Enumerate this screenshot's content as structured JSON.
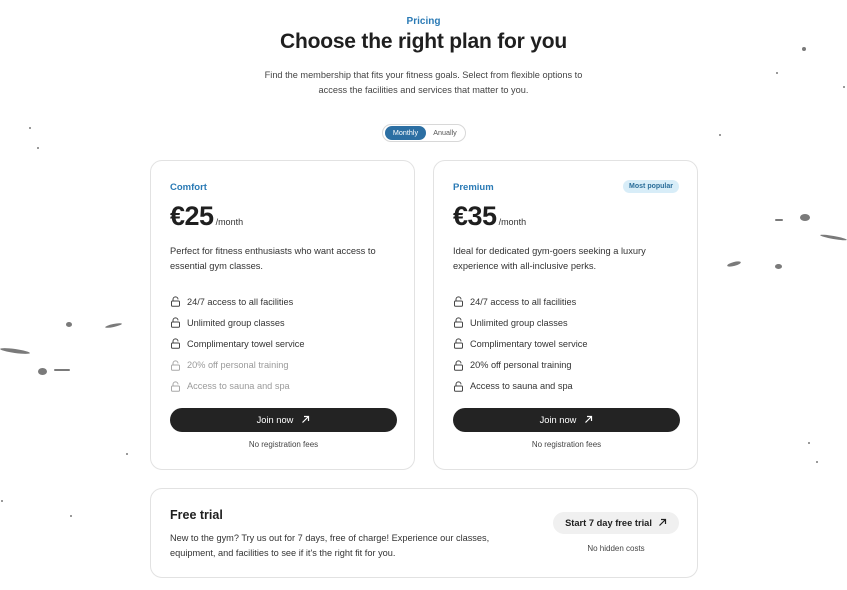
{
  "header": {
    "eyebrow": "Pricing",
    "title": "Choose the right plan for you",
    "subtitle": "Find the membership that fits your fitness goals. Select from flexible options to access the facilities and services that matter to you."
  },
  "billing_toggle": {
    "options": [
      "Monthly",
      "Anually"
    ],
    "selected": "Monthly"
  },
  "plans": [
    {
      "name": "Comfort",
      "price": "€25",
      "period": "/month",
      "description": "Perfect for fitness enthusiasts who want access to essential gym classes.",
      "features": [
        {
          "label": "24/7 access to all facilities",
          "included": true
        },
        {
          "label": "Unlimited group classes",
          "included": true
        },
        {
          "label": "Complimentary towel service",
          "included": true
        },
        {
          "label": "20% off personal training",
          "included": false
        },
        {
          "label": "Access to sauna and spa",
          "included": false
        }
      ],
      "cta": "Join now",
      "note": "No registration fees"
    },
    {
      "name": "Premium",
      "badge": "Most popular",
      "price": "€35",
      "period": "/month",
      "description": "Ideal for dedicated gym-goers seeking a luxury experience with all-inclusive perks.",
      "features": [
        {
          "label": "24/7 access to all facilities",
          "included": true
        },
        {
          "label": "Unlimited group classes",
          "included": true
        },
        {
          "label": "Complimentary towel service",
          "included": true
        },
        {
          "label": "20% off personal training",
          "included": true
        },
        {
          "label": "Access to sauna and spa",
          "included": true
        }
      ],
      "cta": "Join now",
      "note": "No registration fees"
    }
  ],
  "free_trial": {
    "title": "Free trial",
    "description": "New to the gym? Try us out for 7 days, free of charge! Experience our classes, equipment, and facilities to see if it's the right fit for you.",
    "cta": "Start 7 day free trial",
    "note": "No hidden costs"
  },
  "colors": {
    "accent": "#2a7ab5",
    "toggle_active": "#2c6fa3",
    "button_dark": "#232323",
    "badge_bg": "#d8edf8",
    "muted_text": "#9a9a9a"
  },
  "icons": {
    "feature": "lock-icon",
    "cta": "arrow-up-right-icon"
  }
}
